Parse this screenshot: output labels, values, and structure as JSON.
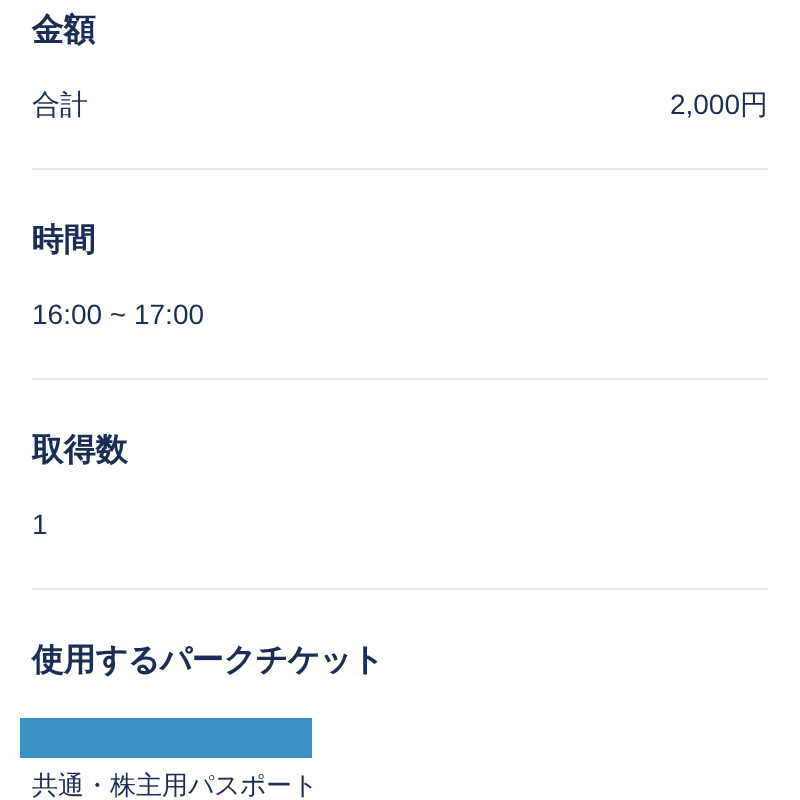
{
  "sections": [
    {
      "heading": "金額",
      "kind": "pair",
      "label": "合計",
      "value": "2,000円"
    },
    {
      "heading": "時間",
      "kind": "text",
      "value": "16:00 ~ 17:00"
    },
    {
      "heading": "取得数",
      "kind": "text",
      "value": "1"
    },
    {
      "heading": "使用するパークチケット",
      "kind": "ticket",
      "value": "共通・株主用パスポート"
    }
  ]
}
